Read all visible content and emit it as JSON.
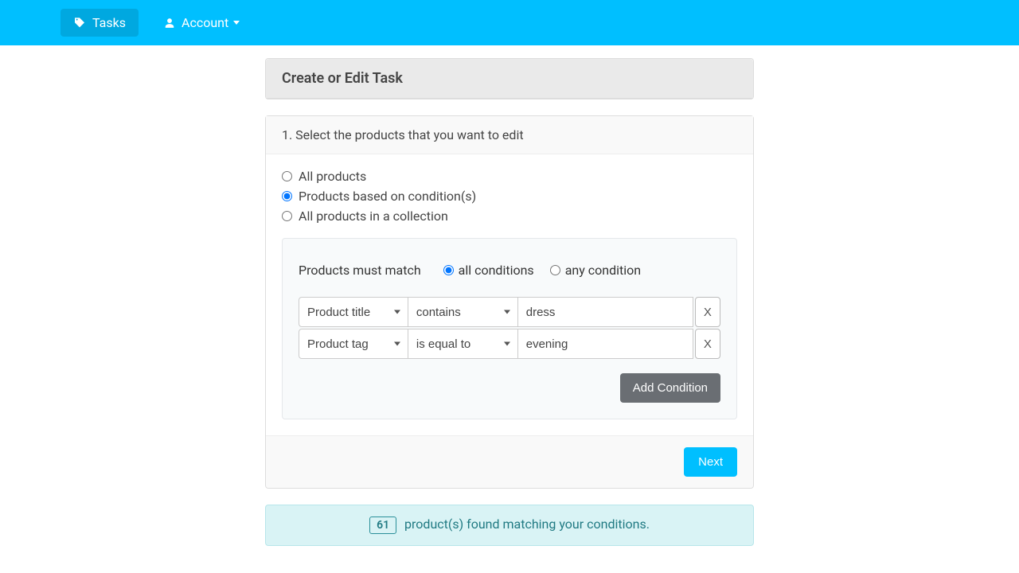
{
  "nav": {
    "tasks": "Tasks",
    "account": "Account"
  },
  "header": {
    "title": "Create or Edit Task"
  },
  "step1": {
    "title": "1. Select the products that you want to edit",
    "options": {
      "all": "All products",
      "cond": "Products based on condition(s)",
      "collection": "All products in a collection"
    }
  },
  "conditions": {
    "match_label": "Products must match",
    "all_label": "all conditions",
    "any_label": "any condition",
    "rows": [
      {
        "field": "Product title",
        "op": "contains",
        "value": "dress"
      },
      {
        "field": "Product tag",
        "op": "is equal to",
        "value": "evening"
      }
    ],
    "remove_label": "X",
    "add_label": "Add Condition"
  },
  "footer": {
    "next": "Next"
  },
  "result": {
    "count": "61",
    "text": "product(s) found matching your conditions."
  }
}
